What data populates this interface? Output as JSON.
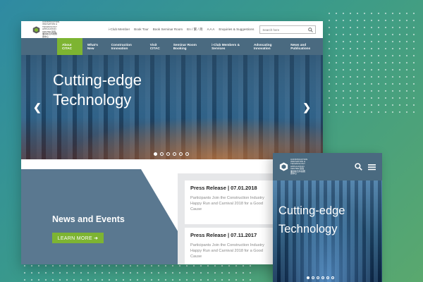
{
  "topbar": {
    "logo_text": "CONSTRUCTION INNOVATION & TECHNOLOGY APPLICATION CENTRE 建造業創新及科技應用中心",
    "links": [
      "i-Club Member",
      "Book Tour",
      "Book Seminar Room",
      "En / 繁 / 简",
      "A A A",
      "Enquiries & Suggestions"
    ],
    "search_placeholder": "Search here"
  },
  "nav": [
    {
      "label": "About CITAC",
      "active": true
    },
    {
      "label": "What's New",
      "active": false
    },
    {
      "label": "Construction Innovation",
      "active": false
    },
    {
      "label": "Visit CITAC",
      "active": false
    },
    {
      "label": "Seminar Room Booking",
      "active": false
    },
    {
      "label": "i-Club Members & Services",
      "active": false
    },
    {
      "label": "Advocating Innovation",
      "active": false
    },
    {
      "label": "News and Publications",
      "active": false
    }
  ],
  "hero": {
    "title": "Cutting-edge Technology",
    "prev_glyph": "❮",
    "next_glyph": "❯",
    "slides": 6,
    "active_slide": 0
  },
  "news": {
    "title": "News and Events",
    "button_label": "LEARN MORE ➜",
    "cards": [
      {
        "heading": "Press Release  |  07.01.2018",
        "body": "Participants Join the Construction Industry Happy Run and Carnival 2018 for a Good Cause"
      },
      {
        "heading": "Press Release  |  07.11.2017",
        "body": "Participants Join the Construction Industry Happy Run and Carnival 2018 for a Good Cause"
      }
    ]
  },
  "mobile": {
    "title": "Cutting-edge Technology",
    "slides": 6,
    "active_slide": 0
  },
  "colors": {
    "accent": "#7db432",
    "nav": "#4a6a80"
  }
}
